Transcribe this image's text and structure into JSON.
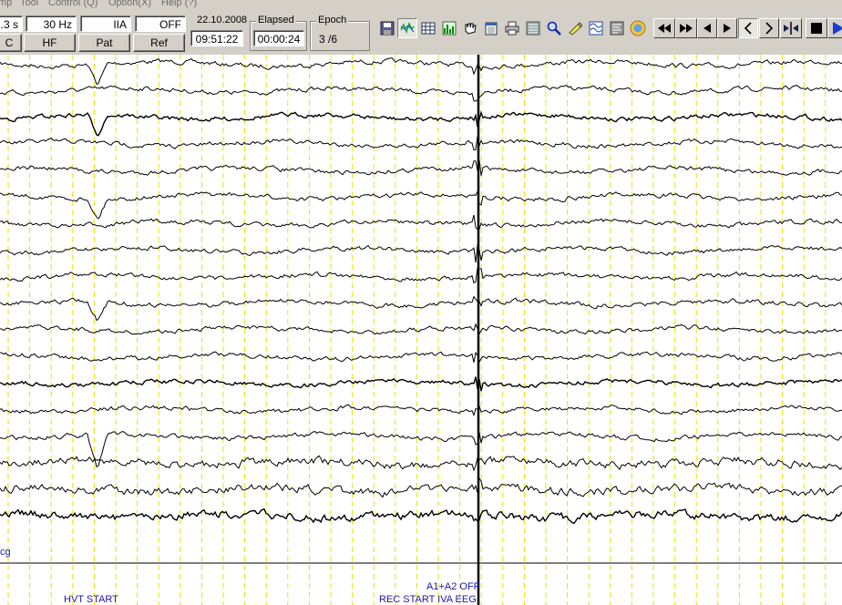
{
  "menu": [
    "mp",
    "Tool",
    "Control (Q)",
    "Option(X)",
    "Help (?)"
  ],
  "settings": {
    "timebase": ".3 s",
    "low_filter": "30 Hz",
    "montage": "IIA",
    "notch": "OFF",
    "btn_c": "C",
    "btn_hf": "HF",
    "btn_pat": "Pat",
    "btn_ref": "Ref"
  },
  "clock": {
    "date": "22.10.2008",
    "time": "09:51:22",
    "elapsed_title": "Elapsed",
    "elapsed": "00:00:24",
    "epoch_title": "Epoch",
    "epoch": "3 /6"
  },
  "toolbar_icons": [
    "save-icon",
    "waveform-icon",
    "grid-icon",
    "spectrum-icon",
    "hand-icon",
    "calendar-icon",
    "print-icon",
    "montage-icon",
    "magnifier-icon",
    "marker-icon",
    "filter-icon",
    "export-icon",
    "globe-icon"
  ],
  "nav_icons": [
    "fast-backward-icon",
    "fast-forward-icon",
    "step-back-icon",
    "step-forward-icon",
    "prev-page-icon",
    "next-page-icon",
    "split-cursor-icon",
    "stop-icon",
    "play-icon"
  ],
  "channel_label": "cg",
  "events": {
    "a1a2": "A1+A2 OFF",
    "hvt": "HVT START",
    "rec": "REC START IVA EEG"
  },
  "colors": {
    "grid": "#e6e600",
    "trace": "#000000",
    "event": "#1a1aa8",
    "toolbar": "#d4d0c8"
  }
}
